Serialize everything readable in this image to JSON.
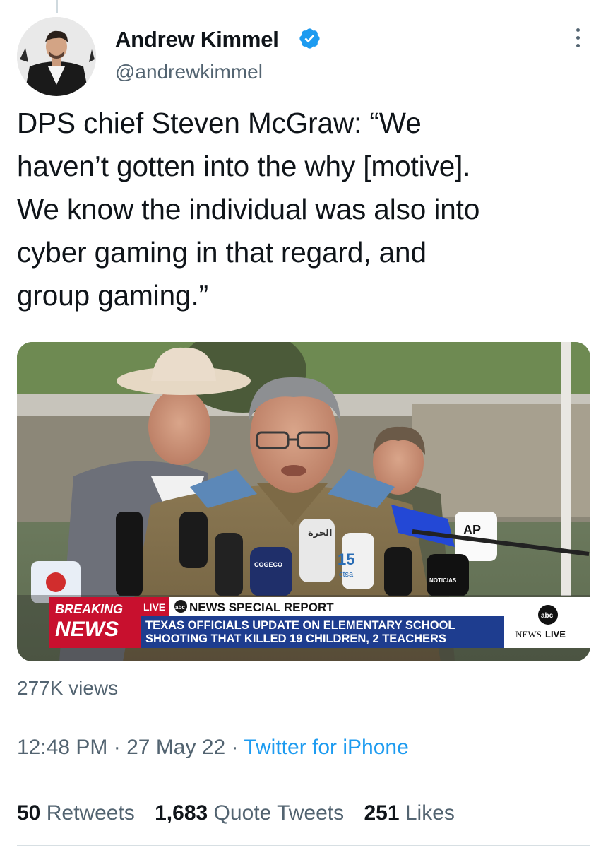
{
  "author": {
    "name": "Andrew Kimmel",
    "handle": "@andrewkimmel",
    "verified": true
  },
  "tweet": {
    "text": "DPS chief Steven McGraw: “We\nhaven’t gotten into the why [motive].\nWe know the individual was also into\ncyber gaming in that regard, and\ngroup gaming.”"
  },
  "media": {
    "banner": {
      "breaking": "BREAKING",
      "news": "NEWS",
      "live": "LIVE",
      "abc_small": "abc",
      "network": "NEWS SPECIAL REPORT",
      "headline_line1": "TEXAS OFFICIALS UPDATE ON ELEMENTARY SCHOOL",
      "headline_line2": "SHOOTING THAT KILLED 19 CHILDREN, 2 TEACHERS",
      "logo_abc": "abc",
      "logo_news": "NEWS",
      "logo_live": "LIVE"
    },
    "mic_labels": {
      "channel15": "15",
      "channel15_sub": "ctsa",
      "ap": "AP",
      "arabic": "الحرة",
      "cogeco": "COGECO",
      "noticias": "NOTICIAS"
    }
  },
  "views": "277K views",
  "timestamp": {
    "time": "12:48 PM",
    "sep": "·",
    "date": "27 May 22",
    "source": "Twitter for iPhone"
  },
  "stats": {
    "retweets_count": "50",
    "retweets_label": "Retweets",
    "quotes_count": "1,683",
    "quotes_label": "Quote Tweets",
    "likes_count": "251",
    "likes_label": "Likes"
  },
  "colors": {
    "verified_blue": "#1d9bf0",
    "link_blue": "#1d9bf0",
    "secondary_text": "#536471",
    "breaking_red": "#c8102e",
    "banner_blue": "#1e3d8f"
  }
}
